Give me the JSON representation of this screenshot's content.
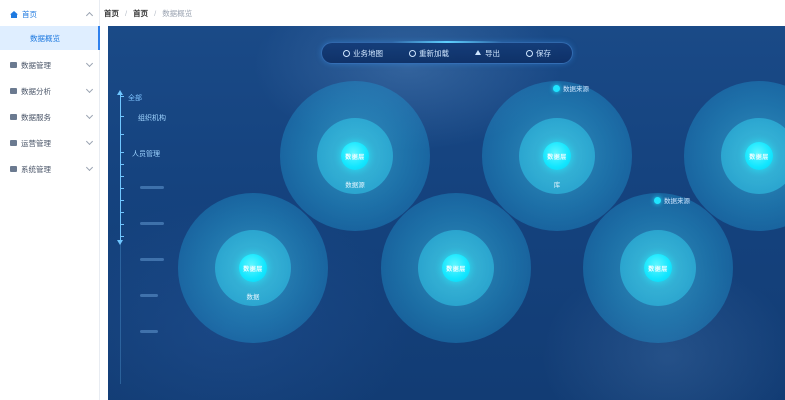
{
  "sidebar": {
    "home_label": "首页",
    "active_sub": "数据概览",
    "items": [
      {
        "label": "数据管理"
      },
      {
        "label": "数据分析"
      },
      {
        "label": "数据服务"
      },
      {
        "label": "运营管理"
      },
      {
        "label": "系统管理"
      }
    ]
  },
  "breadcrumb": [
    "首页",
    "首页",
    "数据概览"
  ],
  "toolbar": {
    "items": [
      {
        "label": "业务地图",
        "icon": "gear-icon"
      },
      {
        "label": "重新加载",
        "icon": "refresh-icon"
      },
      {
        "label": "导出",
        "icon": "export-icon"
      },
      {
        "label": "保存",
        "icon": "save-icon"
      }
    ]
  },
  "timeline": {
    "labels": [
      "全部",
      "组织机构",
      "人员管理"
    ]
  },
  "nodes": [
    {
      "core": "数据层",
      "caption": "数据源",
      "badge": ""
    },
    {
      "core": "数据层",
      "caption": "库",
      "badge": "数据来源"
    },
    {
      "core": "数据层",
      "caption": "",
      "badge": ""
    },
    {
      "core": "数据层",
      "caption": "数据",
      "badge": ""
    },
    {
      "core": "数据层",
      "caption": "",
      "badge": ""
    },
    {
      "core": "数据层",
      "caption": "",
      "badge": "数据来源"
    }
  ],
  "colors": {
    "accent": "#1f7ae0",
    "canvas_bg": "#15437f",
    "node_core": "#12e6ff"
  }
}
